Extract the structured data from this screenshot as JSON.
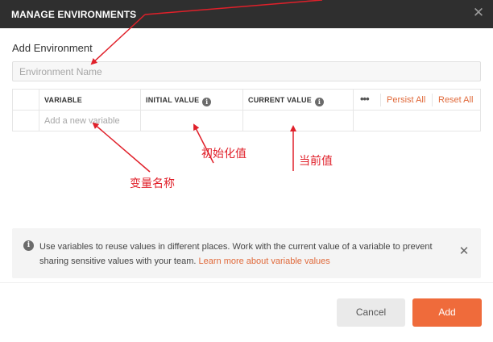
{
  "window": {
    "title": "MANAGE ENVIRONMENTS",
    "close_icon": "close-icon"
  },
  "form": {
    "section_title": "Add Environment",
    "env_name_placeholder": "Environment Name",
    "env_name_value": ""
  },
  "table": {
    "headers": {
      "variable": "VARIABLE",
      "initial_value": "INITIAL VALUE",
      "current_value": "CURRENT VALUE",
      "more": "•••",
      "persist_all": "Persist All",
      "reset_all": "Reset All"
    },
    "rows": [
      {
        "variable_placeholder": "Add a new variable",
        "initial_value": "",
        "current_value": ""
      }
    ]
  },
  "info": {
    "message": "Use variables to reuse values in different places. Work with the current value of a variable to prevent sharing sensitive values with your team.",
    "link_text": "Learn more about variable values"
  },
  "footer": {
    "cancel_label": "Cancel",
    "add_label": "Add"
  },
  "annotations": {
    "variable_name": "变量名称",
    "initial_value": "初始化值",
    "current_value": "当前值"
  },
  "colors": {
    "accent": "#ef6b3b",
    "link": "#e0693a",
    "titlebar": "#2f2f2f",
    "annotation": "#e0202a"
  }
}
